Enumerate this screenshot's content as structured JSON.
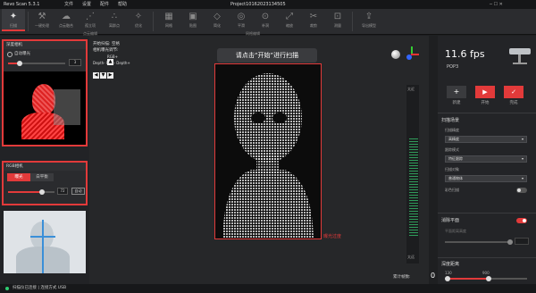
{
  "app": {
    "title": "Revo Scan 5.3.1",
    "project_name": "Project10162023134505"
  },
  "menu": [
    {
      "label": "文件"
    },
    {
      "label": "设置"
    },
    {
      "label": "配件"
    },
    {
      "label": "帮助"
    }
  ],
  "toolbar": {
    "tools": [
      {
        "label": "扫描",
        "icon": "✦"
      },
      {
        "label": "一键处理",
        "icon": "⚒"
      },
      {
        "label": "点云融合",
        "icon": "☁"
      },
      {
        "label": "孤立项",
        "icon": "⋰"
      },
      {
        "label": "离群点",
        "icon": "∴"
      },
      {
        "label": "优化",
        "icon": "✧"
      },
      {
        "label": "网格",
        "icon": "▦"
      },
      {
        "label": "贴图",
        "icon": "▣"
      },
      {
        "label": "简化",
        "icon": "◇"
      },
      {
        "label": "平滑",
        "icon": "◎"
      },
      {
        "label": "补洞",
        "icon": "⊙"
      },
      {
        "label": "缩放",
        "icon": "⤢"
      },
      {
        "label": "裁剪",
        "icon": "✂"
      },
      {
        "label": "测量",
        "icon": "⊡"
      },
      {
        "label": "导出模型",
        "icon": "⇪"
      }
    ],
    "groups": [
      {
        "label": "点云编辑"
      },
      {
        "label": "网格编辑"
      }
    ]
  },
  "left": {
    "depth_camera": {
      "title": "深度相机",
      "auto_exposure_label": "自动曝光",
      "value": "3"
    },
    "rgb_camera": {
      "title": "RGB相机",
      "tabs": [
        "曝光",
        "白平衡"
      ],
      "value": "72",
      "auto_label": "自动"
    }
  },
  "center": {
    "info_lines": [
      "开始扫描: 空格",
      "相机曝光调节:",
      "RGB+",
      "Depth- RGB- Depth+"
    ],
    "prompt": "请点击“开始”进行扫描",
    "overexposed_label": "曝光过度",
    "distance_labels": [
      "太近",
      "太远"
    ]
  },
  "right": {
    "fps": "11.6 fps",
    "device": "POP3",
    "buttons": [
      {
        "label": "新建",
        "icon": "+"
      },
      {
        "label": "开始",
        "icon": "▶"
      },
      {
        "label": "完成",
        "icon": "✓"
      }
    ],
    "scene_section": "扫描场景",
    "fields": [
      {
        "label": "扫描精度",
        "value": "高精度"
      },
      {
        "label": "跟踪模式",
        "value": "特征跟踪"
      },
      {
        "label": "扫描对象",
        "value": "普通物体"
      }
    ],
    "color_scan_label": "彩色扫描",
    "remove_plane_label": "消除平面",
    "plane_height_label": "平面距离高度",
    "scan_distance_label": "深度距离",
    "distance_range": [
      "130",
      "900"
    ],
    "cumulative_frames_label": "累计帧数:",
    "cumulative_frames": "0"
  },
  "status": {
    "text": "扫描仪已连接 | 连接方式 USB"
  },
  "colors": {
    "accent": "#e23a3a",
    "panel": "#2a2b2e"
  }
}
